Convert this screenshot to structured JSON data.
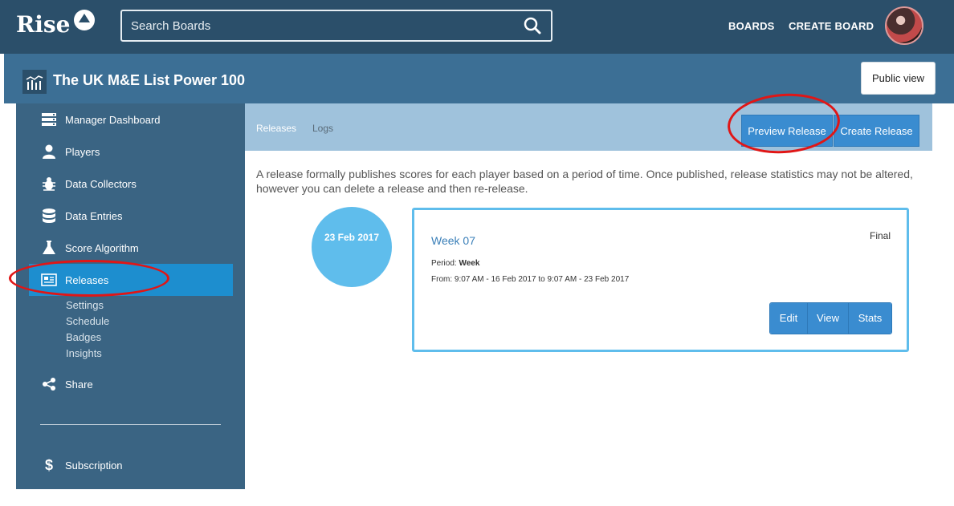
{
  "app": {
    "logo": "Rise"
  },
  "search": {
    "placeholder": "Search Boards"
  },
  "nav": {
    "boards": "BOARDS",
    "create_board": "CREATE BOARD"
  },
  "board": {
    "title": "The UK M&E List Power 100",
    "public_view": "Public view"
  },
  "sidebar": {
    "items": [
      {
        "label": "Manager Dashboard",
        "icon": "dashboard-icon"
      },
      {
        "label": "Players",
        "icon": "user-icon"
      },
      {
        "label": "Data Collectors",
        "icon": "bug-icon"
      },
      {
        "label": "Data Entries",
        "icon": "database-icon"
      },
      {
        "label": "Score Algorithm",
        "icon": "flask-icon"
      },
      {
        "label": "Releases",
        "icon": "newspaper-icon"
      }
    ],
    "sub_items": [
      "Settings",
      "Schedule",
      "Badges",
      "Insights"
    ],
    "share": "Share",
    "subscription": "Subscription"
  },
  "tabs": {
    "releases": "Releases",
    "logs": "Logs"
  },
  "actions": {
    "preview_release": "Preview Release",
    "create_release": "Create Release"
  },
  "description": "A release formally publishes scores for each player based on a period of time. Once published, release statistics may not be altered, however you can delete a release and then re-release.",
  "release": {
    "date": "23 Feb 2017",
    "title": "Week 07",
    "status": "Final",
    "period_label": "Period:",
    "period_value": "Week",
    "range": "From: 9:07 AM - 16 Feb 2017 to 9:07 AM - 23 Feb 2017",
    "buttons": {
      "edit": "Edit",
      "view": "View",
      "stats": "Stats"
    }
  },
  "colors": {
    "topbar": "#2b4f6a",
    "boardbar": "#3c6f95",
    "sidebar": "#3a6483",
    "active": "#1d8ecf",
    "button": "#3a8cd0",
    "annotation": "#e01616"
  }
}
